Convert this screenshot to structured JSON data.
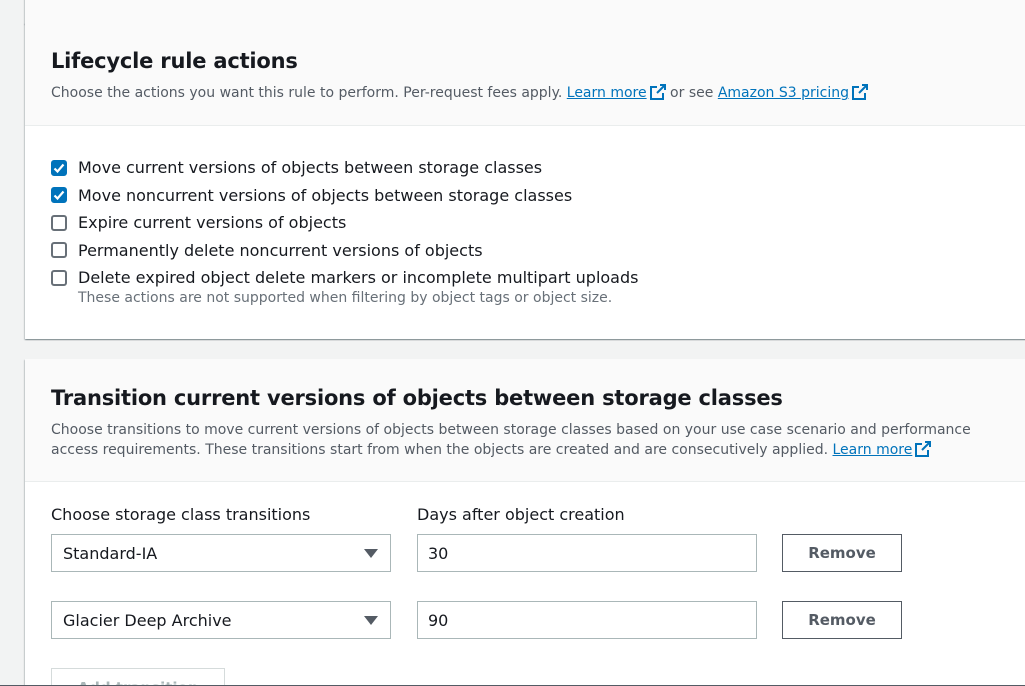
{
  "actions": {
    "title": "Lifecycle rule actions",
    "desc_prefix": "Choose the actions you want this rule to perform. Per-request fees apply. ",
    "learn_more": "Learn more",
    "or_see": " or see ",
    "pricing_link": "Amazon S3 pricing",
    "checkboxes": [
      {
        "label": "Move current versions of objects between storage classes",
        "checked": true
      },
      {
        "label": "Move noncurrent versions of objects between storage classes",
        "checked": true
      },
      {
        "label": "Expire current versions of objects",
        "checked": false
      },
      {
        "label": "Permanently delete noncurrent versions of objects",
        "checked": false
      },
      {
        "label": "Delete expired object delete markers or incomplete multipart uploads",
        "checked": false
      }
    ],
    "note": "These actions are not supported when filtering by object tags or object size."
  },
  "transitions": {
    "title": "Transition current versions of objects between storage classes",
    "desc": "Choose transitions to move current versions of objects between storage classes based on your use case scenario and performance access requirements. These transitions start from when the objects are created and are consecutively applied. ",
    "learn_more": "Learn more",
    "col_storage_label": "Choose storage class transitions",
    "col_days_label": "Days after object creation",
    "rows": [
      {
        "storage_class": "Standard-IA",
        "days": "30",
        "remove_label": "Remove"
      },
      {
        "storage_class": "Glacier Deep Archive",
        "days": "90",
        "remove_label": "Remove"
      }
    ],
    "add_label": "Add transition"
  },
  "colors": {
    "accent": "#0073bb",
    "link": "#0073bb",
    "text": "#16191f",
    "muted": "#545b64"
  }
}
